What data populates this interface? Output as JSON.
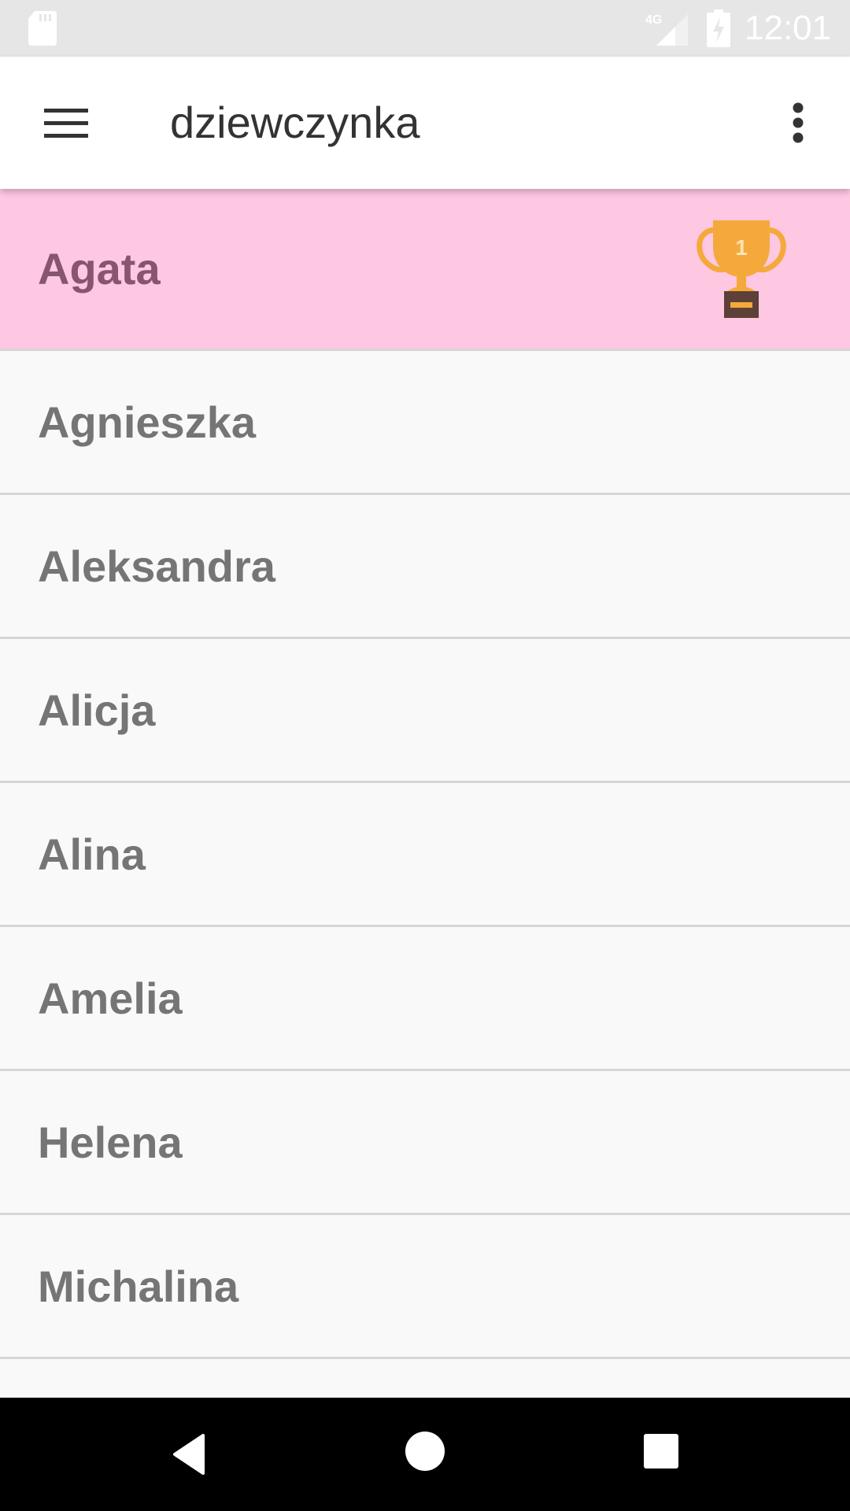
{
  "status_bar": {
    "time": "12:01",
    "network_label": "4G",
    "icons": [
      "sd-card-icon",
      "signal-icon",
      "battery-charging-icon"
    ]
  },
  "app_bar": {
    "title": "dziewczynka",
    "icons": [
      "menu-icon",
      "more-vert-icon"
    ]
  },
  "list": {
    "items": [
      {
        "label": "Agata",
        "highlighted": true,
        "badge": {
          "icon": "trophy-icon",
          "rank": "1"
        }
      },
      {
        "label": "Agnieszka"
      },
      {
        "label": "Aleksandra"
      },
      {
        "label": "Alicja"
      },
      {
        "label": "Alina"
      },
      {
        "label": "Amelia"
      },
      {
        "label": "Helena"
      },
      {
        "label": "Michalina"
      }
    ]
  },
  "nav_bar": {
    "icons": [
      "back-icon",
      "home-icon",
      "recents-icon"
    ]
  },
  "colors": {
    "highlight_background": "#fec8e2",
    "highlight_text": "#87566e",
    "item_text": "#757575",
    "trophy": "#f5a93b"
  }
}
